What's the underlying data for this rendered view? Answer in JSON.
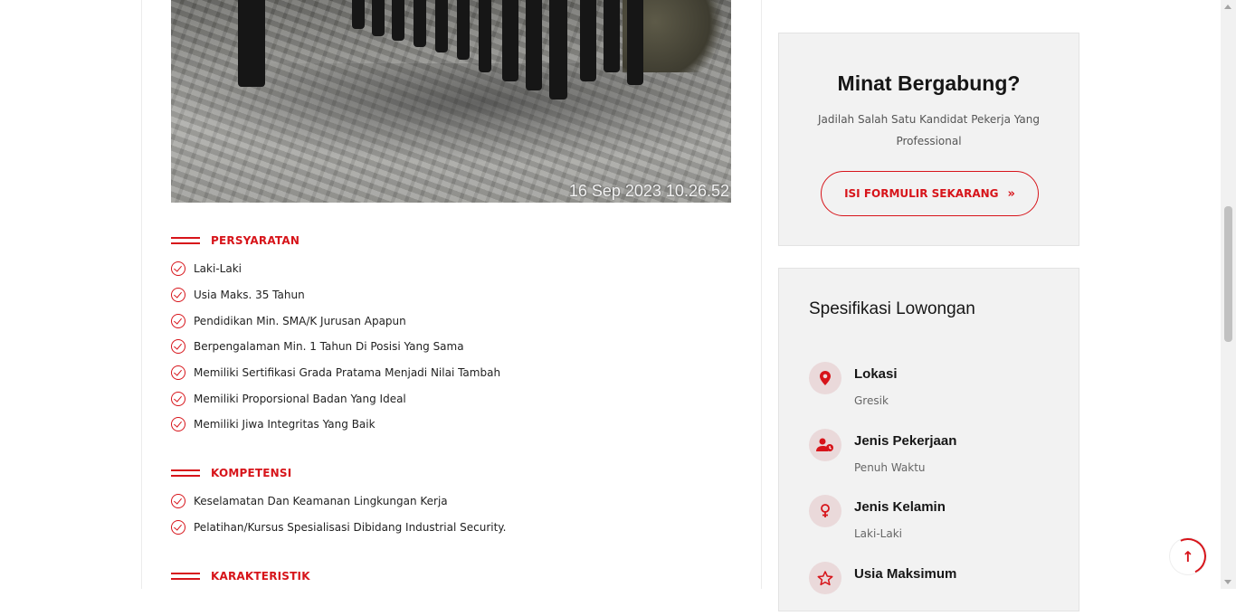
{
  "photo": {
    "timestamp": "16 Sep 2023 10.26.52"
  },
  "sections": {
    "requirements": {
      "title": "PERSYARATAN",
      "items": [
        "Laki-Laki",
        "Usia Maks. 35 Tahun",
        "Pendidikan Min. SMA/K Jurusan Apapun",
        "Berpengalaman Min. 1 Tahun Di Posisi Yang Sama",
        "Memiliki Sertifikasi Grada Pratama Menjadi Nilai Tambah",
        "Memiliki Proporsional Badan Yang Ideal",
        "Memiliki Jiwa Integritas Yang Baik"
      ]
    },
    "competence": {
      "title": "KOMPETENSI",
      "items": [
        "Keselamatan Dan Keamanan Lingkungan Kerja",
        "Pelatihan/Kursus Spesialisasi Dibidang Industrial Security."
      ]
    },
    "characteristics": {
      "title": "KARAKTERISTIK"
    }
  },
  "cta": {
    "title": "Minat Bergabung?",
    "subtitle": "Jadilah Salah Satu Kandidat Pekerja Yang Professional",
    "button_label": "ISI FORMULIR SEKARANG",
    "button_icon": "double-chevron-right-icon"
  },
  "spec": {
    "title": "Spesifikasi Lowongan",
    "items": [
      {
        "label": "Lokasi",
        "value": "Gresik",
        "icon": "map-pin-icon"
      },
      {
        "label": "Jenis Pekerjaan",
        "value": "Penuh Waktu",
        "icon": "user-clock-icon"
      },
      {
        "label": "Jenis Kelamin",
        "value": "Laki-Laki",
        "icon": "gender-icon"
      },
      {
        "label": "Usia Maksimum",
        "value": "",
        "icon": "star-icon"
      }
    ]
  },
  "colors": {
    "accent": "#d7141a",
    "card_bg": "#f2f2f2",
    "icon_bg": "#ead9da"
  }
}
